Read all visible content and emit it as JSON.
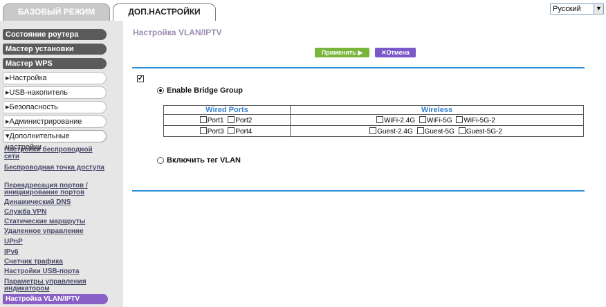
{
  "tabs": {
    "basic": "БАЗОВЫЙ РЕЖИМ",
    "advanced": "ДОП.НАСТРОЙКИ"
  },
  "language": {
    "selected": "Русский",
    "arrow": "▼"
  },
  "sidebar": {
    "router_status": "Состояние роутера",
    "setup_wizard": "Мастер установки",
    "wps_wizard": "Мастер WPS",
    "setup": "▸Настройка",
    "usb_storage": "▸USB-накопитель",
    "security": "▸Безопасность",
    "administration": "▸Администрирование",
    "advanced_setup": "▾Дополнительные настройки",
    "sub_items": [
      "Настройки беспроводной сети",
      "Беспроводная точка доступа",
      "Переадресация портов / инициирование портов",
      "Динамический DNS",
      "Служба VPN",
      "Статические маршруты",
      "Удаленное управление",
      "UPnP",
      "IPv6",
      "Счетчик трафика",
      "Настройки USB-порта",
      "Параметры управления индикатором"
    ],
    "active": "Настройка VLAN/IPTV"
  },
  "main": {
    "title": "Настройка VLAN/IPTV",
    "apply_label": "Применить ▶",
    "cancel_label": "✕Отмена",
    "enable_checked": true,
    "bridge_label": "Enable Bridge Group",
    "vlan_label": "Включить тег VLAN",
    "table": {
      "wired_header": "Wired Ports",
      "wireless_header": "Wireless",
      "port1": "Port1",
      "port2": "Port2",
      "port3": "Port3",
      "port4": "Port4",
      "wifi24": "WiFi-2.4G",
      "wifi5": "WiFi-5G",
      "wifi52": "WiFi-5G-2",
      "guest24": "Guest-2.4G",
      "guest5": "Guest-5G",
      "guest52": "Guest-5G-2"
    }
  },
  "colors": {
    "accent_purple": "#8a60c6",
    "apply_green": "#78b53a",
    "rule_blue": "#2a8ed8",
    "title_lilac": "#9c8cb4"
  }
}
